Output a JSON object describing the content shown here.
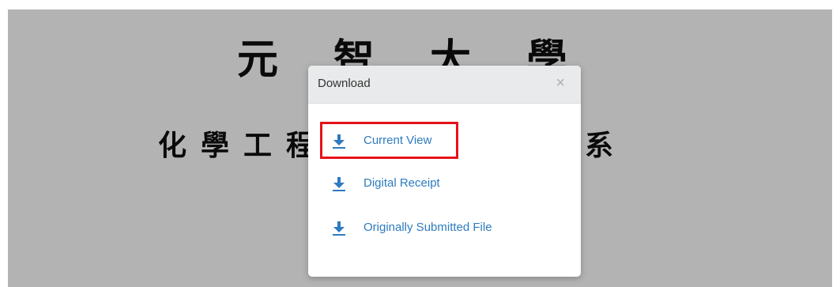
{
  "document": {
    "line1": "元智大學",
    "line2": "化學工程與材料科學學系"
  },
  "dialog": {
    "title": "Download",
    "close_glyph": "×",
    "options": [
      {
        "label": "Current View",
        "icon": "download-icon"
      },
      {
        "label": "Digital Receipt",
        "icon": "download-icon"
      },
      {
        "label": "Originally Submitted File",
        "icon": "download-icon"
      }
    ]
  },
  "colors": {
    "viewer_bg": "#b3b3b3",
    "header_bg": "#e9eaeb",
    "link": "#2e7bbf",
    "highlight": "#e5121b"
  }
}
